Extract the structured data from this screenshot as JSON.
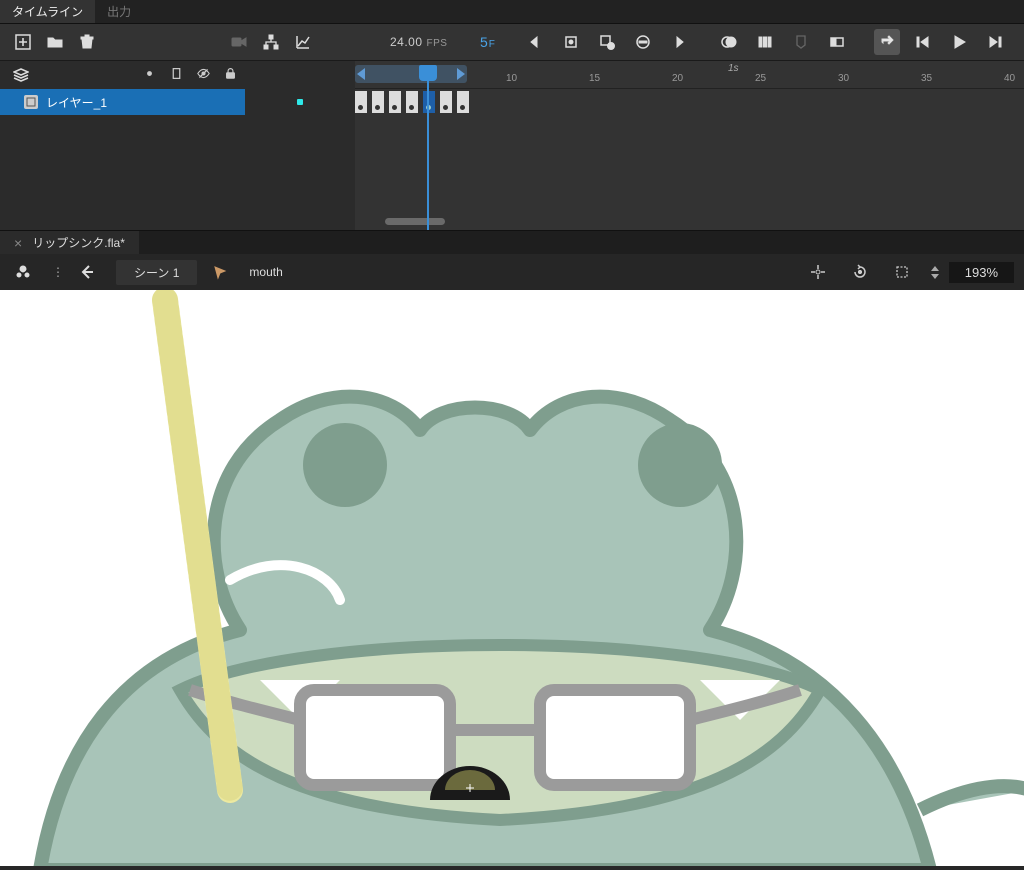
{
  "tabs": {
    "timeline": "タイムライン",
    "output": "出力"
  },
  "fps": {
    "value": "24.00",
    "label": "FPS"
  },
  "current_frame": {
    "value": "5",
    "label": "F"
  },
  "time_marker": "1s",
  "ruler_ticks": [
    "10",
    "15",
    "20",
    "25",
    "30",
    "35",
    "40"
  ],
  "layers": [
    {
      "name": "レイヤー_1"
    }
  ],
  "file": {
    "name": "リップシンク.fla*"
  },
  "breadcrumb": {
    "scene": "シーン 1",
    "symbol": "mouth"
  },
  "zoom": "193%"
}
